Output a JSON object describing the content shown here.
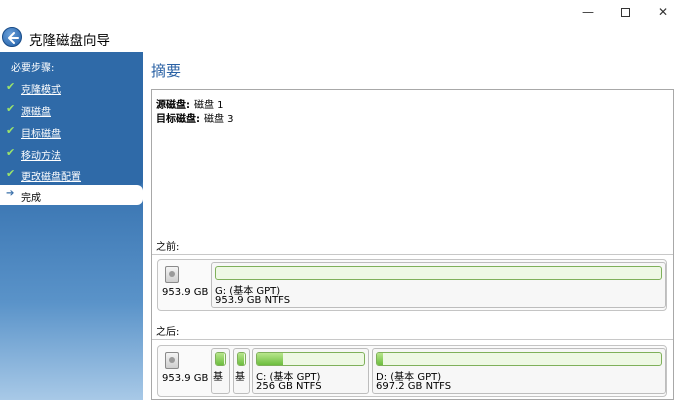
{
  "window": {
    "title": "克隆磁盘向导",
    "min_glyph": "—",
    "close_glyph": "✕"
  },
  "sidebar": {
    "heading": "必要步骤:",
    "items": [
      {
        "label": "克隆模式",
        "done": true
      },
      {
        "label": "源磁盘",
        "done": true
      },
      {
        "label": "目标磁盘",
        "done": true
      },
      {
        "label": "移动方法",
        "done": true
      },
      {
        "label": "更改磁盘配置",
        "done": true
      }
    ],
    "current": {
      "label": "完成"
    },
    "check_glyph": "✔",
    "arrow_glyph": "➔"
  },
  "main": {
    "section_title": "摘要",
    "summary": [
      {
        "key": "源磁盘:",
        "value": "磁盘 1"
      },
      {
        "key": "目标磁盘:",
        "value": "磁盘 3"
      }
    ],
    "before": {
      "label": "之前:",
      "disk_size": "953.9 GB",
      "partitions": [
        {
          "name": "G: (基本 GPT)",
          "info": "953.9 GB  NTFS",
          "used_fraction": 0.0
        }
      ]
    },
    "after": {
      "label": "之后:",
      "disk_size": "953.9 GB",
      "partitions": [
        {
          "name": "基",
          "info": "",
          "used_fraction": 0.9
        },
        {
          "name": "基",
          "info": "",
          "used_fraction": 0.9
        },
        {
          "name": "C: (基本 GPT)",
          "info": "256 GB  NTFS",
          "used_fraction": 0.24
        },
        {
          "name": "D: (基本 GPT)",
          "info": "697.2 GB  NTFS",
          "used_fraction": 0.02
        }
      ]
    }
  },
  "colors": {
    "sidebar_blue": "#3b75b2",
    "title_blue": "#2b62a5",
    "bar_green": "#6cbd3e"
  },
  "icons": {
    "back": "back-arrow-icon",
    "disk": "hard-disk-icon",
    "check": "check-icon",
    "current": "current-step-arrow-icon"
  }
}
